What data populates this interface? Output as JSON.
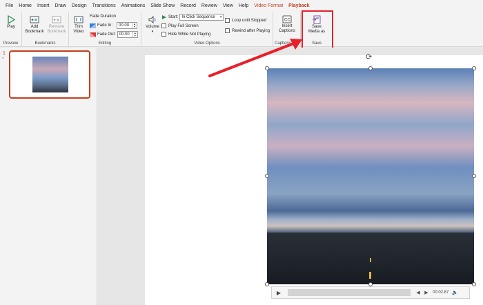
{
  "menu": {
    "items": [
      "File",
      "Home",
      "Insert",
      "Draw",
      "Design",
      "Transitions",
      "Animations",
      "Slide Show",
      "Record",
      "Review",
      "View",
      "Help"
    ],
    "context_tab": "Video Format",
    "active_tab": "Playback"
  },
  "ribbon": {
    "preview": {
      "play_label": "Play",
      "group_label": "Preview"
    },
    "bookmarks": {
      "add_label": "Add\nBookmark",
      "remove_label": "Remove\nBookmark",
      "group_label": "Bookmarks"
    },
    "editing": {
      "trim_label": "Trim\nVideo",
      "fade_duration_label": "Fade Duration",
      "fade_in_label": "Fade In:",
      "fade_in_value": "00.00",
      "fade_out_label": "Fade Out:",
      "fade_out_value": "00.00",
      "group_label": "Editing"
    },
    "video_options": {
      "volume_label": "Volume",
      "start_label": "Start:",
      "start_value": "In Click Sequence",
      "play_full_screen": "Play Full Screen",
      "hide_while_not_playing": "Hide While Not Playing",
      "loop_until_stopped": "Loop until Stopped",
      "rewind_after_playing": "Rewind after Playing",
      "group_label": "Video Options"
    },
    "captions": {
      "insert_label": "Insert\nCaptions",
      "group_label": "Captions"
    },
    "save": {
      "save_media_label": "Save\nMedia as",
      "group_label": "Save"
    }
  },
  "sidebar": {
    "slide_number": "1",
    "slide_marker": "*"
  },
  "video": {
    "time": "00:02.87"
  },
  "colors": {
    "accent": "#c43e1c",
    "highlight": "#e8202a"
  }
}
